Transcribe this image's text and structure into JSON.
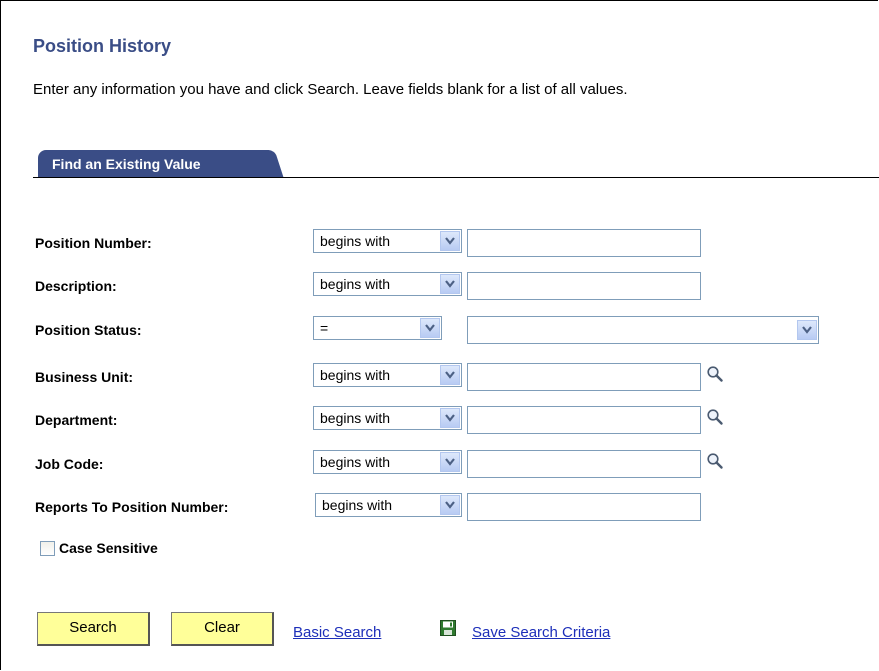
{
  "page": {
    "title": "Position History",
    "instructions": "Enter any information you have and click Search. Leave fields blank for a list of all values."
  },
  "tab": {
    "label": "Find an Existing Value"
  },
  "fields": [
    {
      "label": "Position Number:",
      "operator": "begins with",
      "value": ""
    },
    {
      "label": "Description:",
      "operator": "begins with",
      "value": ""
    },
    {
      "label": "Position Status:",
      "operator": "=",
      "value": ""
    },
    {
      "label": "Business Unit:",
      "operator": "begins with",
      "value": ""
    },
    {
      "label": "Department:",
      "operator": "begins with",
      "value": ""
    },
    {
      "label": "Job Code:",
      "operator": "begins with",
      "value": ""
    },
    {
      "label": "Reports To Position Number:",
      "operator": "begins with",
      "value": ""
    }
  ],
  "case_sensitive": {
    "label": "Case Sensitive",
    "checked": false
  },
  "actions": {
    "search": "Search",
    "clear": "Clear",
    "basic_search": "Basic Search",
    "save_criteria": "Save Search Criteria"
  },
  "icons": {
    "dropdown": "chevron-down-icon",
    "lookup": "magnifier-icon",
    "save": "floppy-disk-icon"
  },
  "colors": {
    "title": "#3a4d86",
    "tab": "#3a4d86",
    "button": "#ffff99",
    "link": "#1d2fb9",
    "input_border": "#7f9db9"
  }
}
